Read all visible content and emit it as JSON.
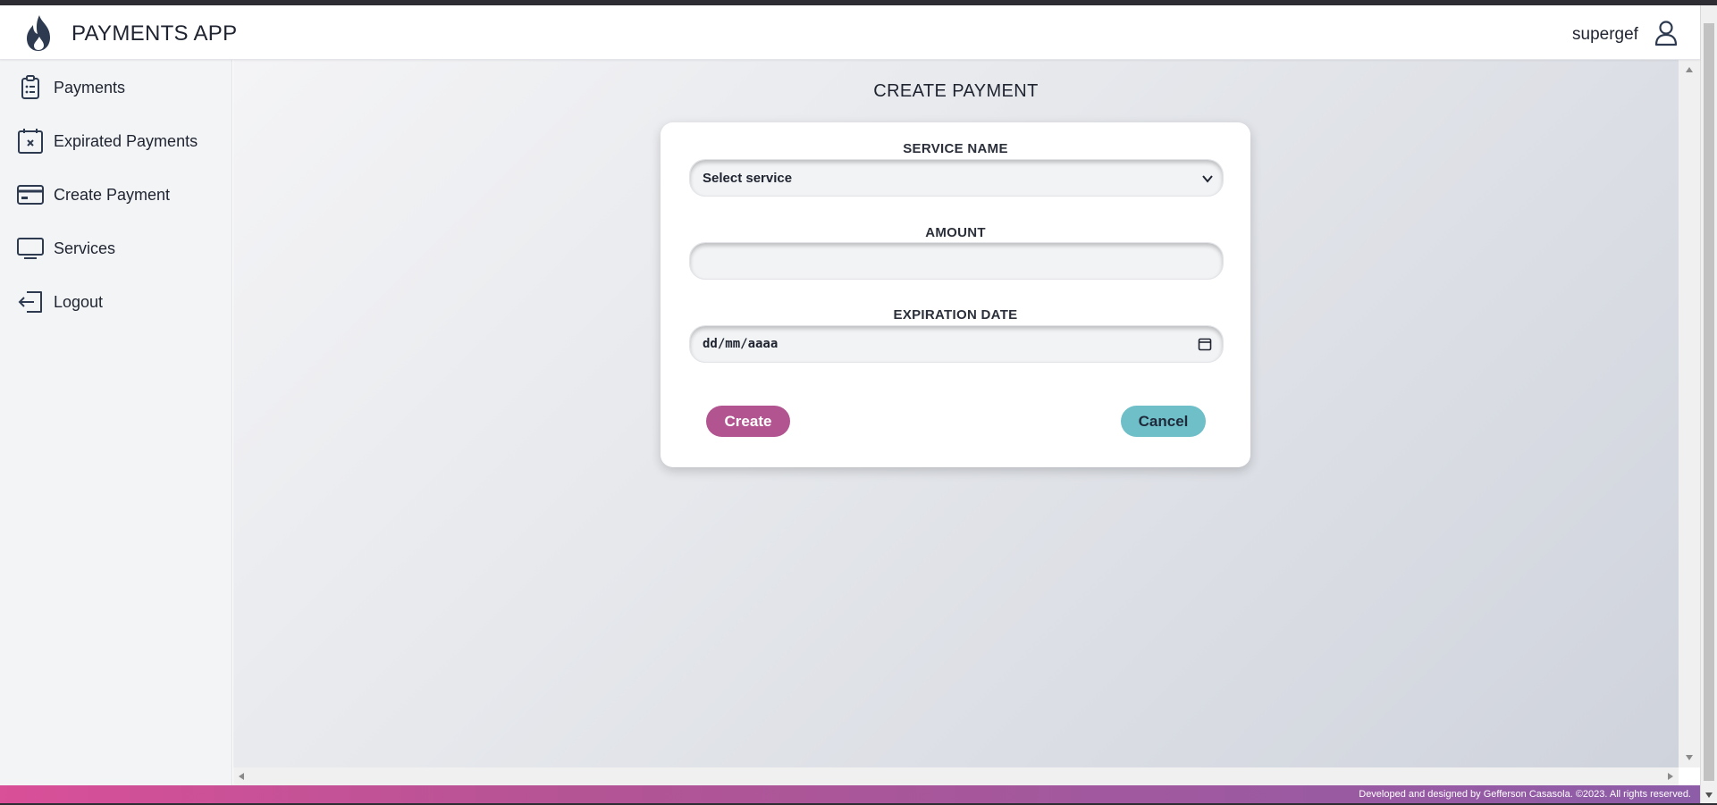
{
  "app": {
    "title": "PAYMENTS APP"
  },
  "user": {
    "name": "supergef"
  },
  "sidebar": {
    "items": [
      {
        "label": "Payments",
        "icon": "clipboard-icon"
      },
      {
        "label": "Expirated Payments",
        "icon": "calendar-x-icon"
      },
      {
        "label": "Create Payment",
        "icon": "credit-card-icon"
      },
      {
        "label": "Services",
        "icon": "monitor-icon"
      },
      {
        "label": "Logout",
        "icon": "logout-icon"
      }
    ]
  },
  "page": {
    "title": "CREATE PAYMENT"
  },
  "form": {
    "service_label": "SERVICE NAME",
    "service_value": "Select service",
    "amount_label": "AMOUNT",
    "amount_value": "",
    "expiration_label": "EXPIRATION DATE",
    "expiration_placeholder": "dd/mm/aaaa",
    "create_label": "Create",
    "cancel_label": "Cancel"
  },
  "footer": {
    "text": "Developed and designed by Gefferson Casasola. ©2023. All rights reserved."
  },
  "colors": {
    "brand_dark": "#2d3a4f",
    "create_button": "#b2548f",
    "cancel_button": "#6fbfc9",
    "footer_start": "#d94f98",
    "footer_end": "#8d5da8"
  }
}
